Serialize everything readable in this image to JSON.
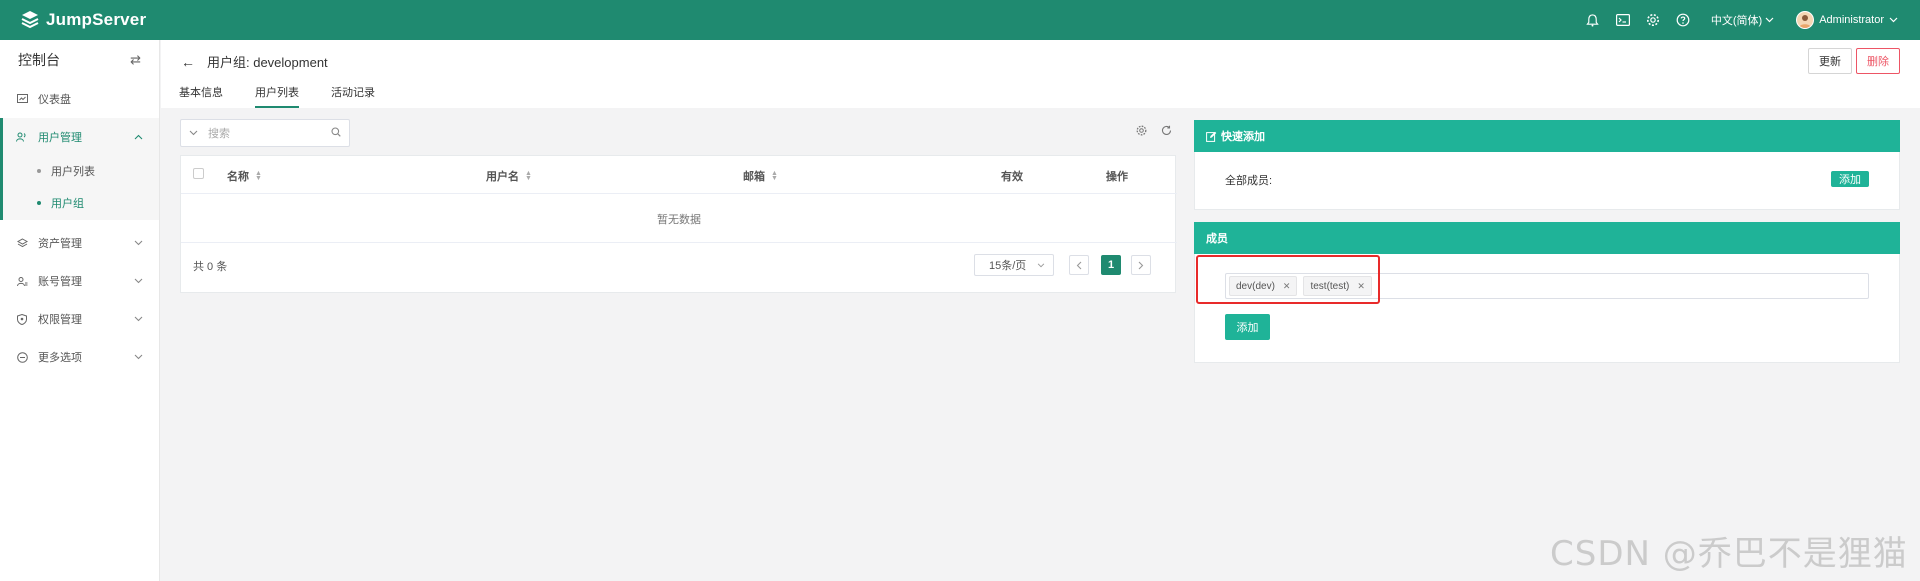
{
  "app": {
    "name": "JumpServer"
  },
  "topbar": {
    "language": "中文(简体)",
    "user": "Administrator"
  },
  "sidebar": {
    "title": "控制台",
    "items": [
      {
        "label": "仪表盘"
      },
      {
        "label": "用户管理",
        "children": [
          "用户列表",
          "用户组"
        ]
      },
      {
        "label": "资产管理"
      },
      {
        "label": "账号管理"
      },
      {
        "label": "权限管理"
      },
      {
        "label": "更多选项"
      }
    ]
  },
  "header": {
    "title": "用户组: development",
    "update_label": "更新",
    "delete_label": "删除",
    "tabs": [
      "基本信息",
      "用户列表",
      "活动记录"
    ],
    "active_tab": "用户列表"
  },
  "search": {
    "placeholder": "搜索"
  },
  "table": {
    "columns": [
      "名称",
      "用户名",
      "邮箱",
      "有效",
      "操作"
    ],
    "empty_text": "暂无数据",
    "total": "共 0 条",
    "page_size": "15条/页",
    "current_page": "1"
  },
  "quick_add": {
    "title": "快速添加",
    "label": "全部成员:",
    "button": "添加"
  },
  "members": {
    "title": "成员",
    "tags": [
      "dev(dev)",
      "test(test)"
    ],
    "button": "添加"
  },
  "watermark": "CSDN @乔巴不是狸猫",
  "colors": {
    "topbar": "#1f8a70",
    "accent": "#1fb398",
    "danger": "#ed5565",
    "highlight": "#e82a2a"
  }
}
